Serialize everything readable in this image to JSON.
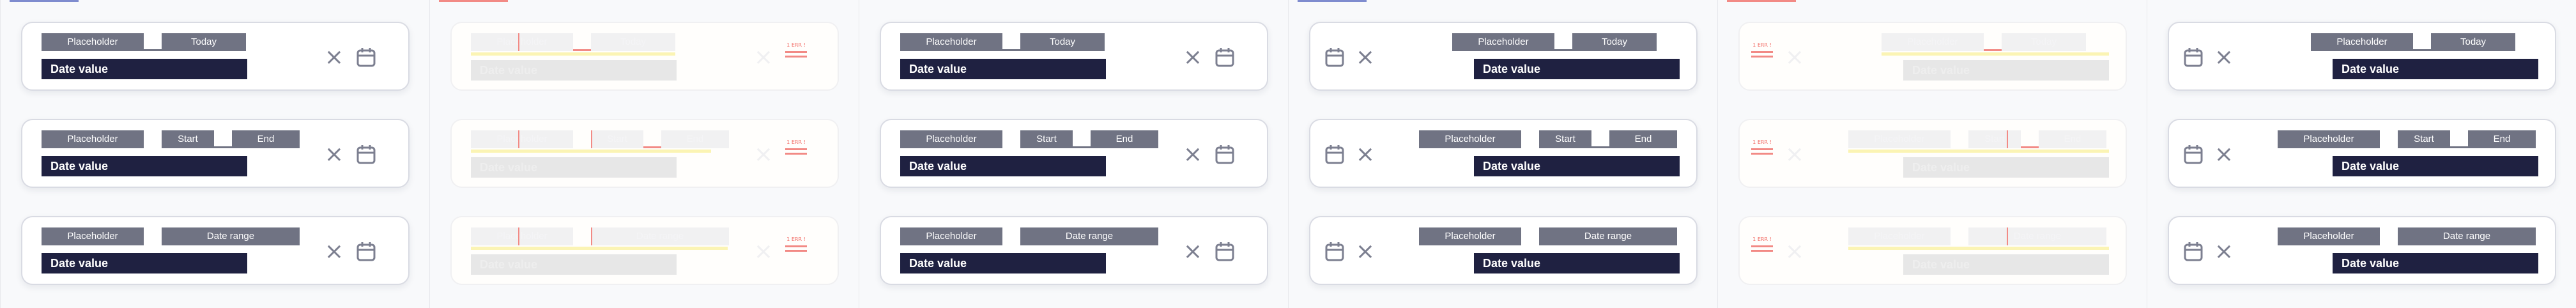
{
  "panels": [
    {
      "variant": "normal-right-icons",
      "rows": [
        {
          "left_chip": "Placeholder",
          "right_chip": "Today",
          "value": "Date value"
        },
        {
          "left_chip": "Placeholder",
          "right_chip_a": "Start",
          "right_chip_b": "End",
          "value": "Date value"
        },
        {
          "left_chip": "Placeholder",
          "right_chip": "Date range",
          "value": "Date value"
        }
      ]
    },
    {
      "variant": "faded-right-error",
      "rows": [
        {
          "left_chip": "Placeholder",
          "right_chip": "Today",
          "value": "Date value",
          "error": "1 ERR !"
        },
        {
          "left_chip": "Placeholder",
          "right_chip_a": "Start",
          "right_chip_b": "End",
          "value": "Date value",
          "error": "1 ERR !"
        },
        {
          "left_chip": "Placeholder",
          "right_chip": "Date range",
          "value": "Date value",
          "error": "1 ERR !"
        }
      ]
    },
    {
      "variant": "normal-right-icons",
      "rows": [
        {
          "left_chip": "Placeholder",
          "right_chip": "Today",
          "value": "Date value"
        },
        {
          "left_chip": "Placeholder",
          "right_chip_a": "Start",
          "right_chip_b": "End",
          "value": "Date value"
        },
        {
          "left_chip": "Placeholder",
          "right_chip": "Date range",
          "value": "Date value"
        }
      ]
    },
    {
      "variant": "normal-left-icons",
      "rows": [
        {
          "left_chip": "Placeholder",
          "right_chip": "Today",
          "value": "Date value"
        },
        {
          "left_chip_a": "Placeholder",
          "left_chip_b": "Start",
          "right_chip": "End",
          "value": "Date value"
        },
        {
          "left_chip": "Placeholder",
          "right_chip": "Date range",
          "value": "Date value"
        }
      ]
    },
    {
      "variant": "faded-left-error",
      "rows": [
        {
          "left_chip": "Placeholder",
          "right_chip": "Today",
          "value": "Date value",
          "error": "1 ERR !"
        },
        {
          "left_chip_a": "Placeholder",
          "left_chip_b": "Start",
          "right_chip": "End",
          "value": "Date value",
          "error": "1 ERR !"
        },
        {
          "left_chip": "Placeholder",
          "right_chip": "Date range",
          "value": "Date value",
          "error": "1 ERR !"
        }
      ]
    },
    {
      "variant": "normal-left-icons",
      "rows": [
        {
          "left_chip": "Placeholder",
          "right_chip": "Today",
          "value": "Date value"
        },
        {
          "left_chip_a": "Placeholder",
          "left_chip_b": "Start",
          "right_chip": "End",
          "value": "Date value"
        },
        {
          "left_chip": "Placeholder",
          "right_chip": "Date range",
          "value": "Date value"
        }
      ]
    }
  ],
  "icons": {
    "close": "close-icon",
    "calendar": "calendar-icon"
  },
  "colors": {
    "chip_bg": "#707383",
    "value_bg": "#1f2141",
    "accent_blue": "#7f8ccf",
    "error_red": "#f28a85",
    "warning_yellow": "#fbf4b4"
  }
}
